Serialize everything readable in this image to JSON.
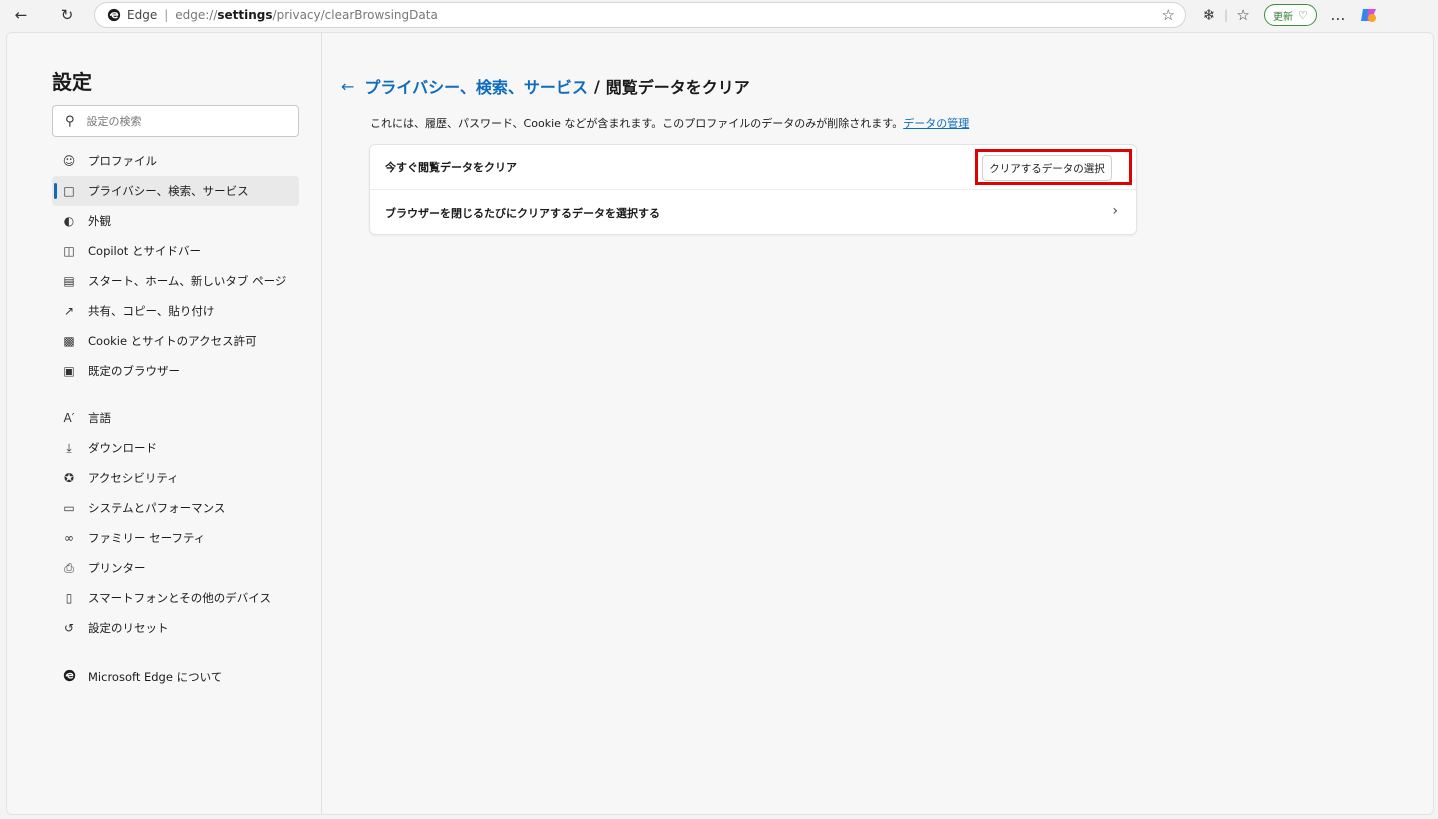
{
  "browser": {
    "site_label": "Edge",
    "url_host": "edge://",
    "url_bold": "settings",
    "url_rest": "/privacy/clearBrowsingData",
    "update_label": "更新",
    "more_label": "…"
  },
  "sidebar": {
    "title": "設定",
    "search_placeholder": "設定の検索",
    "items": [
      {
        "label": "プロファイル",
        "icon": "profile-icon"
      },
      {
        "label": "プライバシー、検索、サービス",
        "icon": "lock-icon"
      },
      {
        "label": "外観",
        "icon": "appearance-icon"
      },
      {
        "label": "Copilot とサイドバー",
        "icon": "sidebar-icon"
      },
      {
        "label": "スタート、ホーム、新しいタブ ページ",
        "icon": "home-tab-icon"
      },
      {
        "label": "共有、コピー、貼り付け",
        "icon": "share-icon"
      },
      {
        "label": "Cookie とサイトのアクセス許可",
        "icon": "cookie-permissions-icon"
      },
      {
        "label": "既定のブラウザー",
        "icon": "default-browser-icon"
      },
      {
        "label": "言語",
        "icon": "language-icon"
      },
      {
        "label": "ダウンロード",
        "icon": "download-icon"
      },
      {
        "label": "アクセシビリティ",
        "icon": "accessibility-icon"
      },
      {
        "label": "システムとパフォーマンス",
        "icon": "system-icon"
      },
      {
        "label": "ファミリー セーフティ",
        "icon": "family-icon"
      },
      {
        "label": "プリンター",
        "icon": "printer-icon"
      },
      {
        "label": "スマートフォンとその他のデバイス",
        "icon": "phone-icon"
      },
      {
        "label": "設定のリセット",
        "icon": "reset-icon"
      },
      {
        "label": "Microsoft Edge について",
        "icon": "edge-icon"
      }
    ]
  },
  "content": {
    "breadcrumb_parent": "プライバシー、検索、サービス",
    "breadcrumb_sep": "/",
    "breadcrumb_current": "閲覧データをクリア",
    "description": "これには、履歴、パスワード、Cookie などが含まれます。このプロファイルのデータのみが削除されます。",
    "manage_link": "データの管理",
    "row1_label": "今すぐ閲覧データをクリア",
    "choose_button": "クリアするデータの選択",
    "row2_label": "ブラウザーを閉じるたびにクリアするデータを選択する"
  },
  "colors": {
    "accent": "#0f6cbd",
    "highlight": "#e00000",
    "update_green": "#2f7d2f"
  }
}
